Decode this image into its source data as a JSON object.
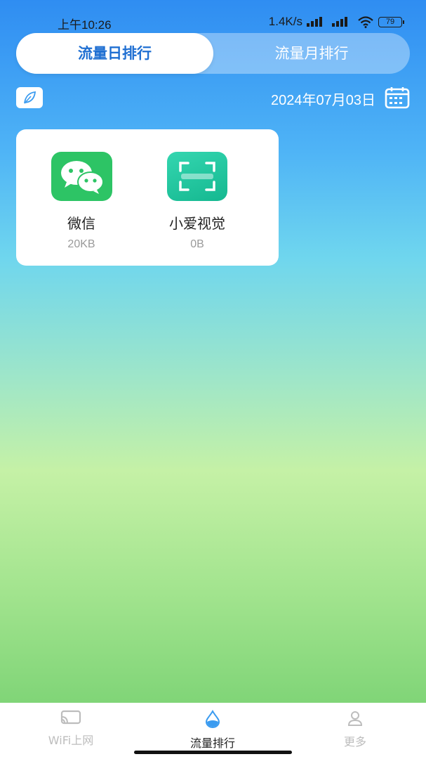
{
  "status_bar": {
    "time": "上午10:26",
    "network_speed": "1.4K/s",
    "battery": "79"
  },
  "tabs": [
    {
      "label": "流量日排行",
      "active": true
    },
    {
      "label": "流量月排行",
      "active": false
    }
  ],
  "date_bar": {
    "left_icon": "leaf-icon",
    "date": "2024年07月03日",
    "calendar_icon": "calendar-icon"
  },
  "apps": [
    {
      "name": "微信",
      "usage": "20KB",
      "icon": "wechat-icon",
      "color": "#2dc465"
    },
    {
      "name": "小爱视觉",
      "usage": "0B",
      "icon": "scan-icon",
      "color": "#20c49f"
    }
  ],
  "bottom_nav": [
    {
      "label": "WiFi上网",
      "icon": "cast-icon",
      "active": false
    },
    {
      "label": "流量排行",
      "icon": "water-drop-icon",
      "active": true
    },
    {
      "label": "更多",
      "icon": "person-icon",
      "active": false
    }
  ],
  "colors": {
    "accent": "#1f6fd2",
    "nav_inactive": "#bdbdbd",
    "nav_active": "#222222"
  }
}
